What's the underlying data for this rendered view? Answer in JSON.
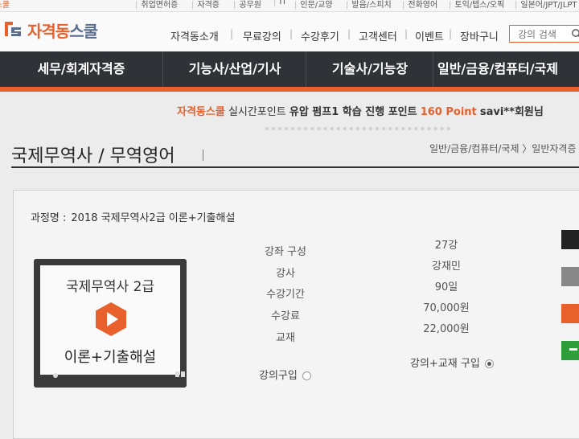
{
  "topbar": {
    "items": [
      {
        "label": "자격증스쿨"
      },
      {
        "label": "취업면허증"
      },
      {
        "label": "자격증"
      },
      {
        "label": "공무원"
      },
      {
        "label": "IT"
      },
      {
        "label": "인문/교양"
      },
      {
        "label": "발음/스피치"
      },
      {
        "label": "전화영어"
      },
      {
        "label": "토익/텝스/오픽"
      },
      {
        "label": "일본어/JPT/JLPT"
      }
    ]
  },
  "header": {
    "logo_text_orange": "자격동",
    "logo_text_blue": "스쿨",
    "gnb": [
      {
        "label": "자격동소개"
      },
      {
        "label": "무료강의"
      },
      {
        "label": "수강후기"
      },
      {
        "label": "고객센터"
      },
      {
        "label": "이벤트"
      },
      {
        "label": "장바구니"
      }
    ],
    "search_placeholder": "강의 검색"
  },
  "nav": {
    "items": [
      {
        "label": "세무/회계자격증"
      },
      {
        "label": "기능사/산업/기사"
      },
      {
        "label": "기술사/기능장"
      },
      {
        "label": "일반/금융/컴퓨터/국제"
      }
    ]
  },
  "ticker": {
    "brand": "자격동스쿨",
    "text1": "실시간포인트",
    "strong": "유압 펌프1 학습 진행 포인트",
    "points": "160 Point",
    "user": "savi**회원님"
  },
  "page": {
    "title": "국제무역사 / 무역영어",
    "breadcrumb": "일반/금융/컴퓨터/국제 〉일반자격증"
  },
  "course": {
    "label": "과정명 :",
    "name": "2018 국제무역사2급 이론+기출해설",
    "thumb_line1": "국제무역사 2급",
    "thumb_line2": "이론+기출해설",
    "info": [
      {
        "label": "강좌 구성",
        "value": "27강"
      },
      {
        "label": "강사",
        "value": "강재민"
      },
      {
        "label": "수강기간",
        "value": "90일"
      },
      {
        "label": "수강료",
        "value": "70,000원"
      },
      {
        "label": "교재",
        "value": "22,000원"
      }
    ],
    "option_lecture": "강의구입",
    "option_bundle": "강의+교재 구입"
  },
  "colors": {
    "accent": "#e8612c",
    "nav_bg": "#2f3236",
    "side_buttons": [
      "#222222",
      "#888888",
      "#e8612c",
      "#2e9e3a"
    ]
  }
}
